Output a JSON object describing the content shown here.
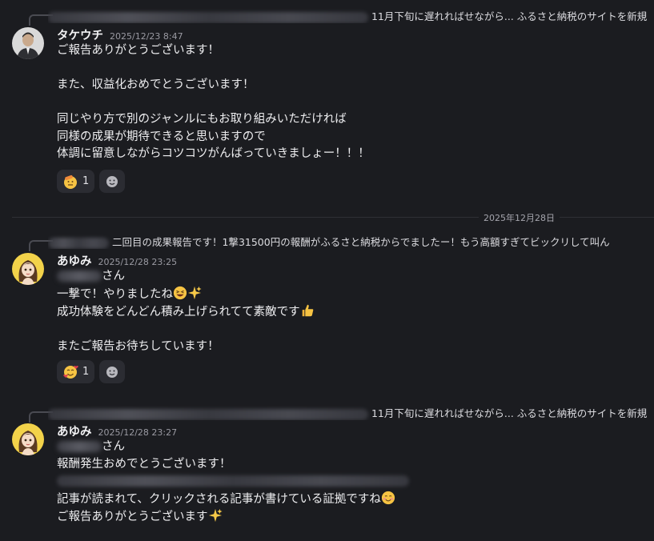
{
  "messages": [
    {
      "reply_preview": "11月下旬に遅れればせながら... ふるさと納税のサイトを新規",
      "author": "タケウチ",
      "time": "2025/12/23 8:47",
      "lines": [
        "ご報告ありがとうございます！",
        "",
        "また、収益化おめでとうございます！",
        "",
        "同じやり方で別のジャンルにもお取り組みいただければ",
        "同様の成果が期待できると思いますので",
        "体調に留意しながらコツコツがんばっていきましょー！！！"
      ],
      "reaction_count": "1",
      "reaction_emoji": "saluting-face"
    },
    {
      "reply_preview": "二回目の成果報告です！1撃31500円の報酬がふるさと納税からでましたー！もう高額すぎてビックリして叫ん",
      "author": "あゆみ",
      "time": "2025/12/28 23:25",
      "lines": [
        "さん",
        "一撃で！やりましたね",
        "成功体験をどんどん積み上げられてて素敵です",
        "",
        "またご報告お待ちしています！"
      ],
      "reaction_count": "1",
      "reaction_emoji": "smiling-face-with-hearts"
    },
    {
      "reply_preview": "11月下旬に遅れればせながら... ふるさと納税のサイトを新規",
      "author": "あゆみ",
      "time": "2025/12/28 23:27",
      "lines": [
        "さん",
        "報酬発生おめでとうございます！",
        "",
        "記事が読まれて、クリックされる記事が書けている証拠ですね",
        "ご報告ありがとうございます"
      ]
    }
  ],
  "date_separator": "2025年12月28日",
  "colors": {
    "background": "#1b1c20",
    "reaction_bg": "#2b2c32",
    "text": "#eeeef0",
    "muted": "#9a9aa2"
  }
}
